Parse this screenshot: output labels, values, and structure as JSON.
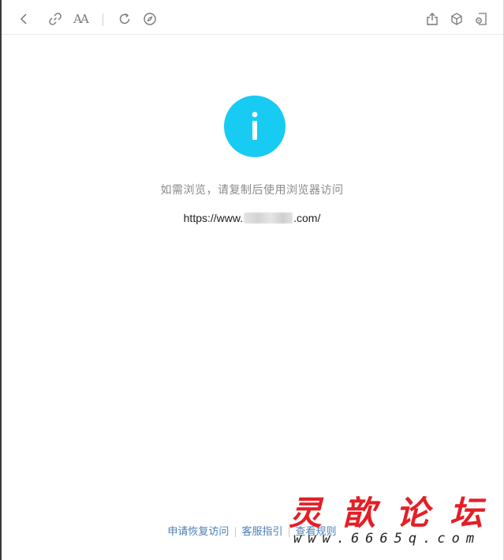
{
  "toolbar": {
    "icons": [
      "back-icon",
      "link-icon",
      "font-size-icon",
      "refresh-icon",
      "compass-icon",
      "share-icon",
      "cube-icon",
      "mini-window-icon"
    ],
    "font_size_label": "AA"
  },
  "colors": {
    "info_circle": "#17cbf2",
    "prompt_text": "#8a8a8a",
    "link": "#4a7fb8",
    "watermark_red": "#e3141b"
  },
  "main": {
    "info_icon_glyph": "i",
    "prompt": "如需浏览，请复制后使用浏览器访问",
    "url_prefix": "https://www.",
    "url_suffix": ".com/"
  },
  "footer": {
    "links": [
      "申请恢复访问",
      "客服指引",
      "查看规则"
    ],
    "separator": "|"
  },
  "watermark": {
    "title": "灵歆论坛",
    "url": "www.6665q.com"
  }
}
